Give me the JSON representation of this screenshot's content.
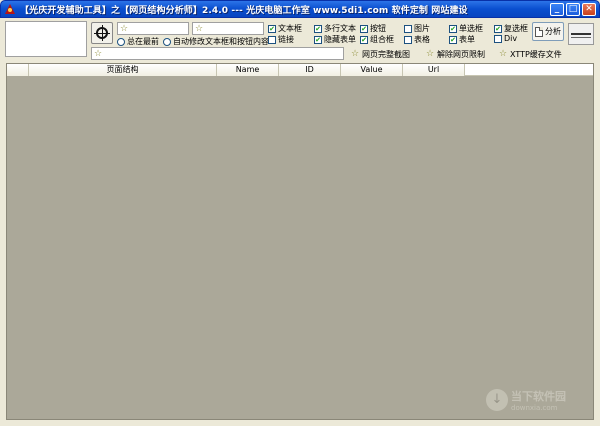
{
  "window": {
    "title": "【光庆开发辅助工具】之【网页结构分析师】2.4.0 --- 光庆电脑工作室  www.5di1.com  软件定制  网站建设",
    "buttons": {
      "minimize": "_",
      "maximize": "□",
      "close": "✕"
    }
  },
  "toolbar": {
    "star_glyph": "☆",
    "options": {
      "always_on_top": "总在最前",
      "auto_modify": "自动修改文本框和按钮内容"
    },
    "filters": [
      {
        "label": "文本框",
        "checked": true
      },
      {
        "label": "多行文本",
        "checked": true
      },
      {
        "label": "按钮",
        "checked": true
      },
      {
        "label": "图片",
        "checked": false
      },
      {
        "label": "单选框",
        "checked": true
      },
      {
        "label": "复选框",
        "checked": true
      },
      {
        "label": "链接",
        "checked": false
      },
      {
        "label": "隐藏表单",
        "checked": true
      },
      {
        "label": "组合框",
        "checked": true
      },
      {
        "label": "表格",
        "checked": false
      },
      {
        "label": "表单",
        "checked": true
      },
      {
        "label": "Div",
        "checked": false
      }
    ],
    "analyze_label": "分析",
    "screenshot_label": "网页完整截图",
    "unlock_label": "解除网页限制",
    "cache_label": "XTTP缓存文件"
  },
  "table": {
    "columns": [
      "页面结构",
      "Name",
      "ID",
      "Value",
      "Url"
    ]
  },
  "watermark": {
    "title": "当下软件园",
    "url": "downxia.com"
  }
}
